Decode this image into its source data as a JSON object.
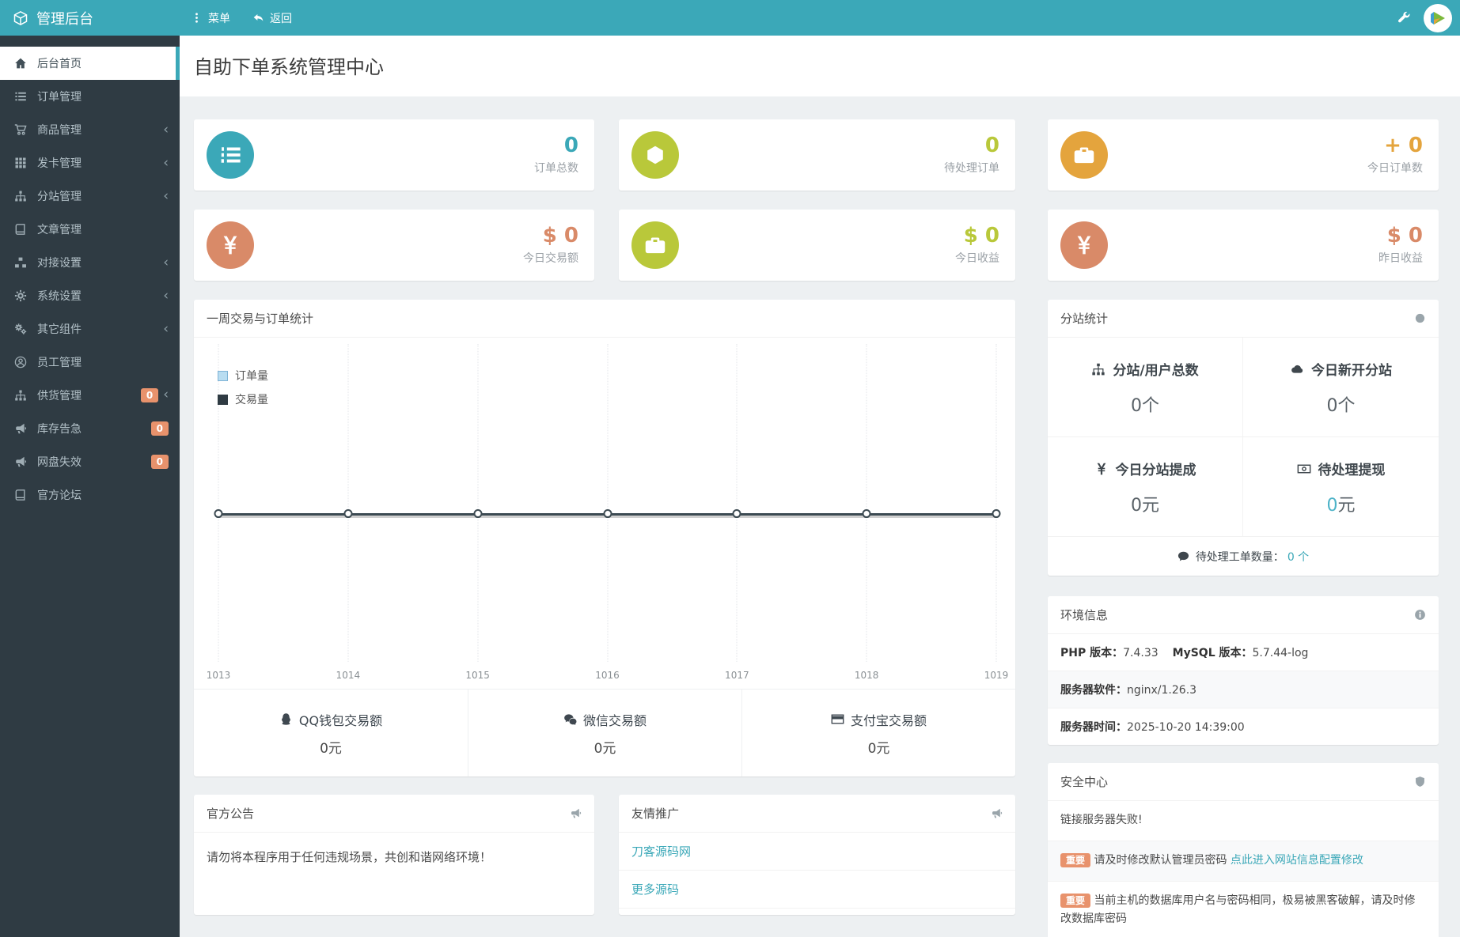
{
  "topbar": {
    "brand": "管理后台",
    "menu_label": "菜单",
    "back_label": "返回",
    "wrench_icon": "wrench-icon",
    "avatar_icon": "play-logo-avatar"
  },
  "sidebar": {
    "items": [
      {
        "label": "后台首页",
        "icon": "home-icon",
        "active": true
      },
      {
        "label": "订单管理",
        "icon": "list-icon"
      },
      {
        "label": "商品管理",
        "icon": "cart-icon",
        "chevron": true
      },
      {
        "label": "发卡管理",
        "icon": "grid-icon",
        "chevron": true
      },
      {
        "label": "分站管理",
        "icon": "sitemap-icon",
        "chevron": true
      },
      {
        "label": "文章管理",
        "icon": "book-icon"
      },
      {
        "label": "对接设置",
        "icon": "nodes-icon",
        "chevron": true
      },
      {
        "label": "系统设置",
        "icon": "gear-icon",
        "chevron": true
      },
      {
        "label": "其它组件",
        "icon": "gears-icon",
        "chevron": true
      },
      {
        "label": "员工管理",
        "icon": "user-circle-icon"
      },
      {
        "label": "供货管理",
        "icon": "sitemap-icon",
        "badge": "0",
        "chevron": true
      },
      {
        "label": "库存告急",
        "icon": "bullhorn-icon",
        "badge": "0"
      },
      {
        "label": "网盘失效",
        "icon": "bullhorn-icon",
        "badge": "0"
      },
      {
        "label": "官方论坛",
        "icon": "book-icon"
      }
    ]
  },
  "page": {
    "title": "自助下单系统管理中心"
  },
  "stat_cards": [
    {
      "value": "0",
      "label": "订单总数",
      "color": "#3ba8b8",
      "icon": "list-ol-icon"
    },
    {
      "value": "0",
      "label": "待处理订单",
      "color": "#b9c83a",
      "icon": "hexagon-icon"
    },
    {
      "value": "+ 0",
      "label": "今日订单数",
      "color": "#e4a43d",
      "icon": "briefcase-icon"
    },
    {
      "value": "$ 0",
      "label": "今日交易额",
      "color": "#d98a68",
      "icon": "yen-icon"
    },
    {
      "value": "$ 0",
      "label": "今日收益",
      "color": "#b9c83a",
      "icon": "briefcase-icon"
    },
    {
      "value": "$ 0",
      "label": "昨日收益",
      "color": "#d98a68",
      "icon": "yen-icon"
    }
  ],
  "chart_data": {
    "type": "line",
    "title": "一周交易与订单统计",
    "x": [
      "1013",
      "1014",
      "1015",
      "1016",
      "1017",
      "1018",
      "1019"
    ],
    "series": [
      {
        "name": "订单量",
        "values": [
          0,
          0,
          0,
          0,
          0,
          0,
          0
        ],
        "swatch_color": "#b9ddf1"
      },
      {
        "name": "交易量",
        "values": [
          0,
          0,
          0,
          0,
          0,
          0,
          0
        ],
        "swatch_color": "#2f3b43"
      }
    ],
    "ylim": [
      0,
      0
    ],
    "grid": "vertical-dotted",
    "legend_position": "top-left",
    "line_color": "#3c4a52",
    "marker_style": "hollow-circle"
  },
  "payment_stats": [
    {
      "label": "QQ钱包交易额",
      "value": "0元",
      "icon": "qq-icon"
    },
    {
      "label": "微信交易额",
      "value": "0元",
      "icon": "wechat-icon"
    },
    {
      "label": "支付宝交易额",
      "value": "0元",
      "icon": "card-icon"
    }
  ],
  "announcement": {
    "title": "官方公告",
    "body": "请勿将本程序用于任何违规场景，共创和谐网络环境！"
  },
  "promotion": {
    "title": "友情推广",
    "links": [
      "刀客源码网",
      "更多源码"
    ]
  },
  "substation": {
    "title": "分站统计",
    "cells": [
      {
        "label": "分站/用户总数",
        "icon": "sitemap-icon",
        "num": "0",
        "unit": "个"
      },
      {
        "label": "今日新开分站",
        "icon": "cloud-icon",
        "num": "0",
        "unit": "个"
      },
      {
        "label": "今日分站提成",
        "icon": "yen-icon",
        "num": "0",
        "unit": "元"
      },
      {
        "label": "待处理提现",
        "icon": "money-bill-icon",
        "num": "0",
        "unit": "元",
        "accent": true
      }
    ],
    "footer_label": "待处理工单数量：",
    "footer_value": "0 个"
  },
  "environment": {
    "title": "环境信息",
    "php_label": "PHP 版本：",
    "php_value": "7.4.33",
    "mysql_label": "MySQL 版本：",
    "mysql_value": "5.7.44-log",
    "server_label": "服务器软件：",
    "server_value": "nginx/1.26.3",
    "time_label": "服务器时间：",
    "time_value": "2025-10-20 14:39:00"
  },
  "security": {
    "title": "安全中心",
    "row1": "链接服务器失败!",
    "badge": "重要",
    "row2_text": "请及时修改默认管理员密码 ",
    "row2_link": "点此进入网站信息配置修改",
    "row3_text": "当前主机的数据库用户名与密码相同，极易被黑客破解，请及时修改数据库密码"
  },
  "colors": {
    "topbar": "#3ba8b8",
    "sidebar": "#2f3b43",
    "accent_teal": "#3ba8b8",
    "badge_orange": "#e8926c",
    "green": "#b9c83a",
    "orange": "#e4a43d",
    "salmon": "#d98a68",
    "content_bg": "#edf0f2"
  }
}
